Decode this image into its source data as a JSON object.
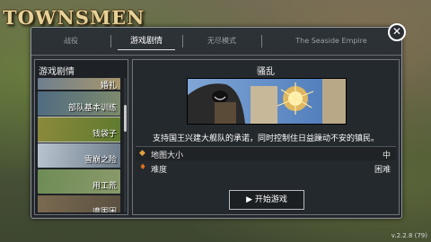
{
  "game": {
    "logo": "TOWNSMEN",
    "version": "v.2.2.8 (79)"
  },
  "tabs": [
    {
      "label": "战役",
      "active": false
    },
    {
      "label": "游戏剧情",
      "active": true
    },
    {
      "label": "无尽模式",
      "active": false
    },
    {
      "label": "The Seaside Empire",
      "active": false
    }
  ],
  "left_panel": {
    "title": "游戏剧情",
    "items": [
      {
        "label": "婚礼",
        "colors": [
          "#6d7f8f",
          "#a9976b"
        ]
      },
      {
        "label": "部队基本训练",
        "colors": [
          "#4f6b82",
          "#7e8b6b"
        ]
      },
      {
        "label": "钱袋子",
        "colors": [
          "#8c8a3c",
          "#5e7a2e"
        ],
        "selected": true
      },
      {
        "label": "雪崩之险",
        "colors": [
          "#b9c4cf",
          "#6d7c8a"
        ]
      },
      {
        "label": "用工荒",
        "colors": [
          "#6e8c56",
          "#8a9a6a"
        ]
      },
      {
        "label": "遭围困",
        "colors": [
          "#7a6a50",
          "#5a5040"
        ]
      }
    ]
  },
  "scenario": {
    "title": "骚乱",
    "description": "支持国王兴建大舰队的承诺，同时控制住日益躁动不安的镇民。",
    "rows": [
      {
        "icon": "map-size-icon",
        "glyph": "◆",
        "glyph_color": "#e0a040",
        "label": "地图大小",
        "value": "中"
      },
      {
        "icon": "torch-icon",
        "glyph": "♦",
        "glyph_color": "#e07020",
        "label": "难度",
        "value": "困难"
      }
    ],
    "start_label": "开始游戏"
  },
  "colors": {
    "accent": "#ffffff",
    "panel": "#24292d",
    "border": "#6e747a"
  }
}
